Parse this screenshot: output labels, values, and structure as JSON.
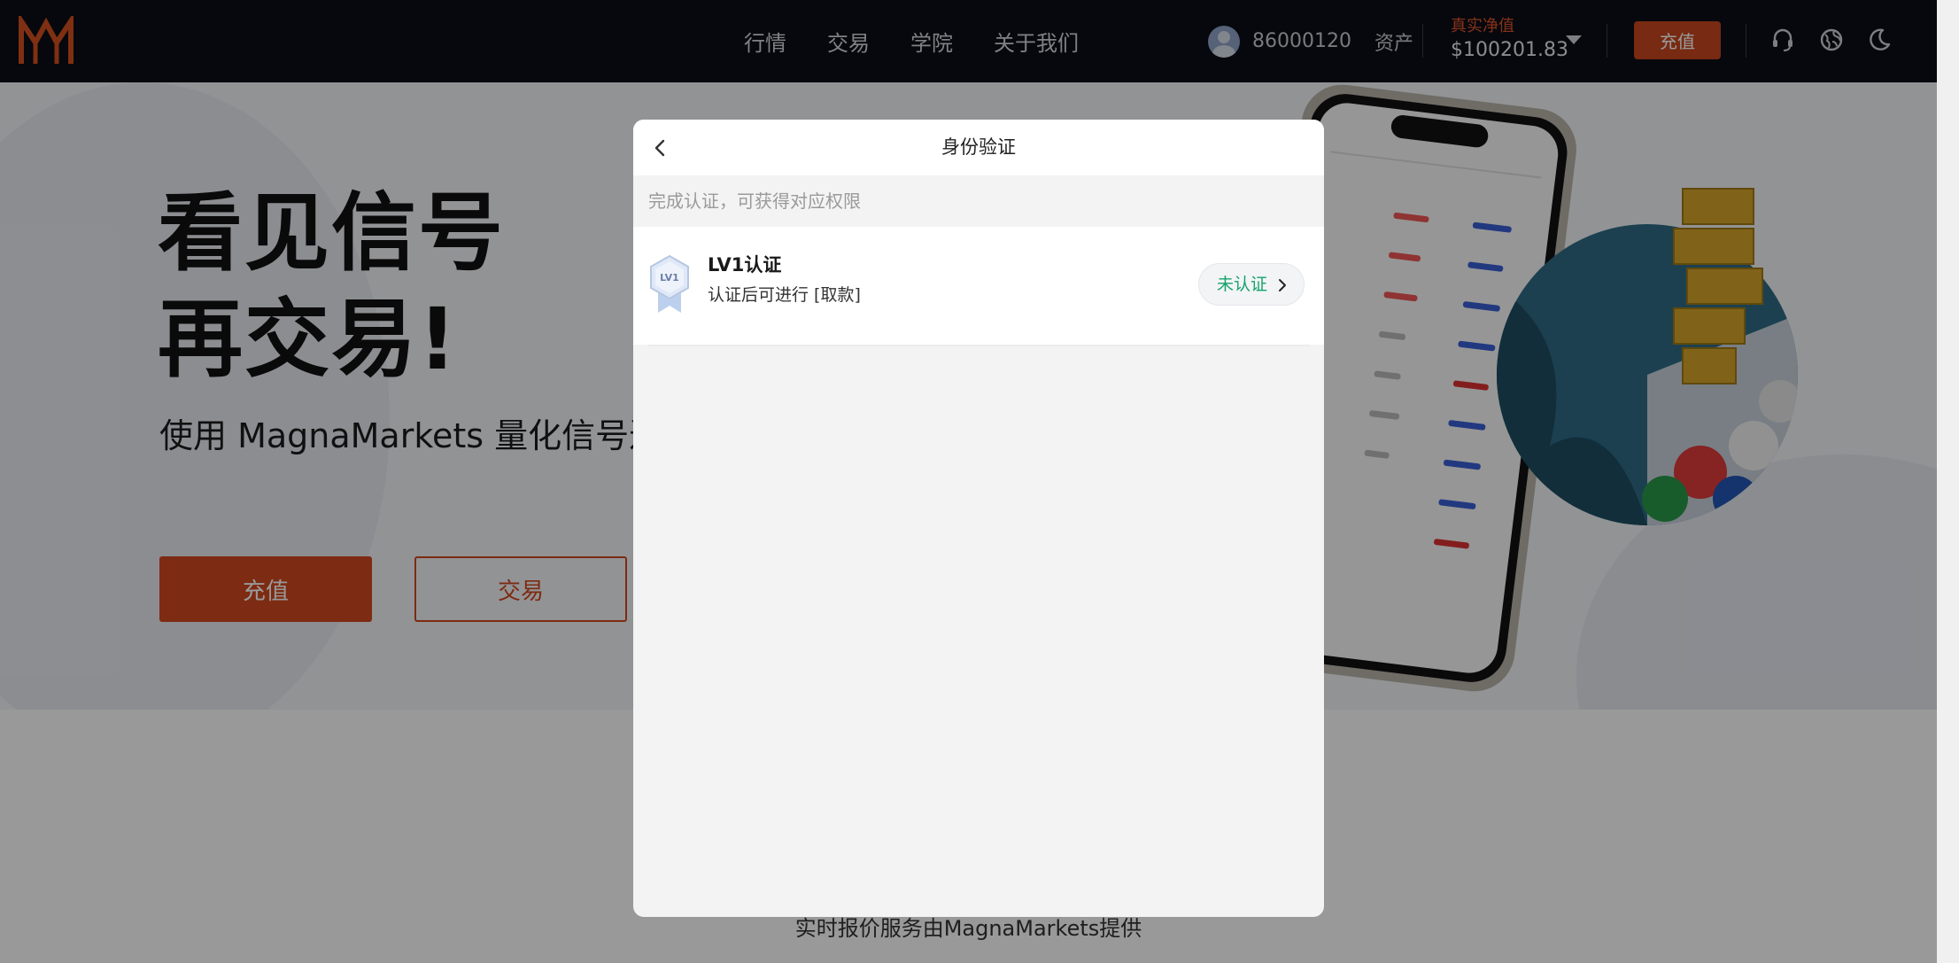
{
  "nav": {
    "links": [
      "行情",
      "交易",
      "学院",
      "关于我们"
    ],
    "user_id": "86000120",
    "assets_label": "资产",
    "equity_label": "真实净值",
    "equity_value": "$100201.83",
    "deposit_label": "充值"
  },
  "hero": {
    "title_line1": "看见信号",
    "title_line2": "再交易!",
    "subtitle": "使用 MagnaMarkets 量化信号进行",
    "deposit_button": "充值",
    "trade_button": "交易"
  },
  "footer": {
    "note": "实时报价服务由MagnaMarkets提供"
  },
  "modal": {
    "title": "身份验证",
    "hint": "完成认证，可获得对应权限",
    "level": {
      "badge_text": "LV1",
      "title": "LV1认证",
      "description": "认证后可进行 [取款]",
      "status": "未认证"
    }
  },
  "colors": {
    "accent": "#d1491f",
    "nav_bg": "#0b0e16",
    "status_green": "#16a36a"
  },
  "icons": [
    "logo-m-icon",
    "headset-icon",
    "globe-icon",
    "moon-icon",
    "chevron-left-icon",
    "chevron-right-icon",
    "caret-down-icon",
    "level-badge-icon"
  ]
}
